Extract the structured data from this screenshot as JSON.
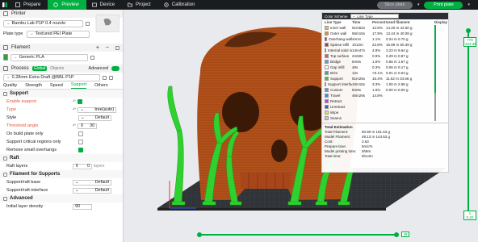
{
  "topbar": {
    "tabs": [
      {
        "label": "Prepare"
      },
      {
        "label": "Preview"
      },
      {
        "label": "Device"
      },
      {
        "label": "Project"
      },
      {
        "label": "Calibration"
      }
    ],
    "slice_label": "Slice plate",
    "print_label": "Print plate"
  },
  "left": {
    "printer_title": "Printer",
    "printer_name": "Bambu Lab P1P 0.4 nozzle",
    "plate_type_label": "Plate type",
    "plate_type_value": "Textured PEI Plate",
    "filament_title": "Filament",
    "filament_value": "Generic PLA",
    "process_title": "Process",
    "process_toggle_global": "Global",
    "process_toggle_objects": "Objects",
    "advanced_label": "Advanced",
    "process_value": "0.28mm Extra Draft @BBL P1P",
    "tabs": [
      "Quality",
      "Strength",
      "Speed",
      "Support",
      "Others"
    ],
    "support_group": "Support",
    "options": [
      {
        "label": "Enable support",
        "value": ""
      },
      {
        "label": "Type",
        "value": "tree(auto)"
      },
      {
        "label": "Style",
        "value": "Default"
      },
      {
        "label": "Threshold angle",
        "value": "30"
      },
      {
        "label": "On build plate only",
        "value": ""
      },
      {
        "label": "Support critical regions only",
        "value": ""
      },
      {
        "label": "Remove small overhangs",
        "value": ""
      }
    ],
    "raft_group": "Raft",
    "raft_layers_label": "Raft layers",
    "raft_layers_value": "0",
    "raft_layers_unit": "layers",
    "fil_support_group": "Filament for Supports",
    "support_base_label": "Support/raft base",
    "support_base_value": "Default",
    "support_interface_label": "Support/raft interface",
    "support_interface_value": "Default",
    "advanced_group": "Advanced",
    "initial_density_label": "Initial layer density",
    "initial_density_value": "90"
  },
  "color_scheme": {
    "header_label": "Color Scheme",
    "select_value": "Line Type",
    "columns": [
      "Line Type",
      "Time",
      "Percent",
      "Used filament",
      "Display"
    ],
    "rows": [
      {
        "name": "Inner wall",
        "color": "#f2b94b",
        "time": "51m52s",
        "percent": "14.5%",
        "used": "14.20 m  42.50 g",
        "display": true
      },
      {
        "name": "Outer wall",
        "color": "#f08a33",
        "time": "56m15s",
        "percent": "17.9%",
        "used": "13.44 m  40.08 g",
        "display": true
      },
      {
        "name": "Overhang wall",
        "color": "#2f4dd7",
        "time": "4m1s",
        "percent": "1.1%",
        "used": "0.24 m  0.70 g",
        "display": true
      },
      {
        "name": "Sparse infill",
        "color": "#b33939",
        "time": "1h12m",
        "percent": "22.8%",
        "used": "16.89 m  50.39 g",
        "display": true
      },
      {
        "name": "Internal solid infill",
        "color": "#a24ecf",
        "time": "14m47s",
        "percent": "4.8%",
        "used": "3.23 m  9.64 g",
        "display": true
      },
      {
        "name": "Top surface",
        "color": "#e85656",
        "time": "2m50s",
        "percent": "0.9%",
        "used": "0.29 m  0.87 g",
        "display": true
      },
      {
        "name": "Bridge",
        "color": "#4fa3e0",
        "time": "5m6s",
        "percent": "1.6%",
        "used": "0.56 m  1.67 g",
        "display": true
      },
      {
        "name": "Gap infill",
        "color": "#ffffff",
        "time": "48s",
        "percent": "0.3%",
        "used": "0.06 m  0.17 g",
        "display": true
      },
      {
        "name": "Brim",
        "color": "#1fb7a1",
        "time": "12s",
        "percent": "<0.1%",
        "used": "0.01 m  0.04 g",
        "display": true
      },
      {
        "name": "Support",
        "color": "#2fd12f",
        "time": "51m25s",
        "percent": "16.4%",
        "used": "11.62 m  34.66 g",
        "display": true
      },
      {
        "name": "Support interface",
        "color": "#2d7a2d",
        "time": "10m15s",
        "percent": "3.3%",
        "used": "1.00 m  2.98 g",
        "display": true
      },
      {
        "name": "Custom",
        "color": "#5e9dc1",
        "time": "5m9s",
        "percent": "1.6%",
        "used": "0.00 m  0.00 g",
        "display": true
      },
      {
        "name": "Travel",
        "color": "#2d8ef0",
        "time": "46m29s",
        "percent": "14.8%",
        "used": "",
        "display": false
      },
      {
        "name": "Retract",
        "color": "#c63cd6",
        "time": "",
        "percent": "",
        "used": "",
        "display": false
      },
      {
        "name": "Unretract",
        "color": "#4a4ae0",
        "time": "",
        "percent": "",
        "used": "",
        "display": false
      },
      {
        "name": "Wipe",
        "color": "#f2e233",
        "time": "",
        "percent": "",
        "used": "",
        "display": false
      },
      {
        "name": "Seams",
        "color": "#c9c9c9",
        "time": "",
        "percent": "",
        "used": "",
        "display": false
      }
    ],
    "estimation_title": "Total Estimation",
    "estimation": [
      {
        "k": "Total Filament:",
        "v": "60.90 m   181.63 g"
      },
      {
        "k": "Model Filament:",
        "v": "49.13 m   144.53 g"
      },
      {
        "k": "Cost:",
        "v": "3.63"
      },
      {
        "k": "Prepare time:",
        "v": "5m47s"
      },
      {
        "k": "Model printing time:",
        "v": "5h8m"
      },
      {
        "k": "Total time:",
        "v": "5h14m"
      }
    ]
  },
  "sliders": {
    "layer_top": "778",
    "height_top": "223.36",
    "layer_bottom": "1",
    "height_bottom": "0.20",
    "move_label": "48"
  },
  "colors": {
    "accent": "#00ae42",
    "model_wall": "#b4511a",
    "support": "#2fd12f"
  }
}
